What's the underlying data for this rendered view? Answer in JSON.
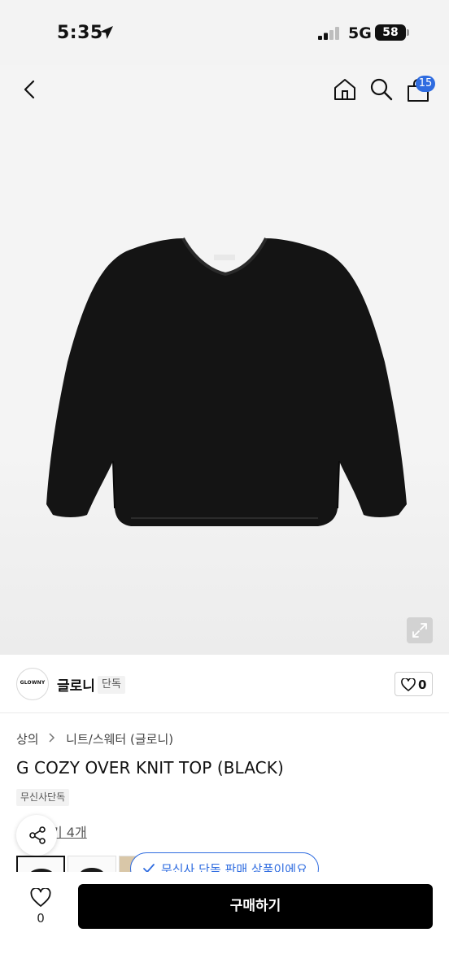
{
  "status_bar": {
    "time": "5:35",
    "network": "5G",
    "battery": "58"
  },
  "header": {
    "cart_count": "15",
    "icons": [
      "back-icon",
      "home-icon",
      "search-icon",
      "cart-icon"
    ]
  },
  "hero": {
    "expand_icon": "expand-icon"
  },
  "brand": {
    "logo_text": "GLOWNY",
    "name": "글로니",
    "badge": "단독",
    "like_count": "0"
  },
  "product": {
    "breadcrumb": [
      "상의",
      "니트/스웨터 (글로니)"
    ],
    "title": "G COZY OVER KNIT TOP (BLACK)",
    "tag": "무신사단독",
    "review_text": "기 4개"
  },
  "notice": {
    "text": "무신사 단독 판매 상품이에요"
  },
  "bottom_bar": {
    "wish_count": "0",
    "buy_label": "구매하기"
  },
  "colors": {
    "accent": "#2f6ce0",
    "buy_button": "#000000",
    "background": "#f4f4f4"
  }
}
